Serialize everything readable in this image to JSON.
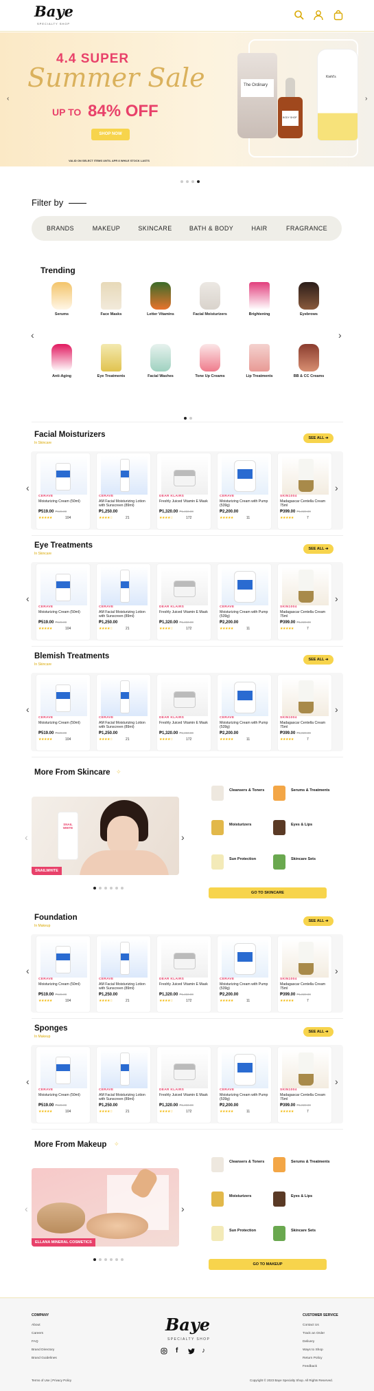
{
  "header": {
    "logo": "Baye",
    "logo_sub": "SPECIALTY SHOP",
    "icons": [
      "search-icon",
      "user-icon",
      "bag-icon"
    ]
  },
  "hero": {
    "line1": "4.4 SUPER",
    "line2": "Summer Sale",
    "upto": "UP TO",
    "percent": "84% OFF",
    "button": "SHOP NOW",
    "note": "VALID ON SELECT ITEMS UNTIL APR 8 WHILE STOCK LASTS",
    "slides": 4,
    "active_slide": 4,
    "product_texts": [
      "The Ordinary",
      "BODY SHOP",
      "Kiehl's"
    ]
  },
  "filter": {
    "title": "Filter by",
    "items": [
      "BRANDS",
      "MAKEUP",
      "SKINCARE",
      "BATH & BODY",
      "HAIR",
      "FRAGRANCE"
    ]
  },
  "trending": {
    "title": "Trending",
    "row1": [
      "Serums",
      "Face Masks",
      "Letter Vitamins",
      "Facial Moisturizers",
      "Brightening",
      "Eyebrows"
    ],
    "row2": [
      "Anti-Aging",
      "Eye Treatments",
      "Facial Washes",
      "Tone Up Creams",
      "Lip Treatments",
      "BB & CC Creams"
    ]
  },
  "product_sections": [
    {
      "title": "Facial Moisturizers",
      "sub": "In Skincare",
      "see_all": "SEE ALL ➔"
    },
    {
      "title": "Eye Treatments",
      "sub": "In Skincare",
      "see_all": "SEE ALL ➔"
    },
    {
      "title": "Blemish Treatments",
      "sub": "In Skincare",
      "see_all": "SEE ALL ➔"
    },
    {
      "title": "Foundation",
      "sub": "In Makeup",
      "see_all": "SEE ALL ➔"
    },
    {
      "title": "Sponges",
      "sub": "In Makeup",
      "see_all": "SEE ALL ➔"
    }
  ],
  "products": [
    {
      "brand": "CERAVE",
      "name": "Moisturizing Cream (50ml)",
      "price": "₱519.00",
      "old": "₱649.00",
      "stars": "★★★★★",
      "count": "104"
    },
    {
      "brand": "CERAVE",
      "name": "AM Facial Moisturizing Lotion with Sunscreen (89ml)",
      "price": "₱1,250.00",
      "old": "",
      "stars": "★★★★☆",
      "count": "21"
    },
    {
      "brand": "DEAR KLAIRS",
      "name": "Freshly Juiced Vitamin E Mask",
      "price": "₱1,320.00",
      "old": "₱1,450.00",
      "stars": "★★★★☆",
      "count": "172"
    },
    {
      "brand": "CERAVE",
      "name": "Moisturizing Cream with Pump (539g)",
      "price": "₱2,200.00",
      "old": "",
      "stars": "★★★★★",
      "count": "11"
    },
    {
      "brand": "SKIN1004",
      "name": "Madagascar Centella Cream 75ml",
      "price": "₱399.00",
      "old": "₱1,020.00",
      "stars": "★★★★★",
      "count": "7"
    }
  ],
  "more_skincare": {
    "title": "More From Skincare",
    "tag": "SNAILWHITE",
    "img_text": "SNAIL WHITE",
    "cats": [
      "Cleansers & Toners",
      "Serums & Treatments",
      "Moisturizers",
      "Eyes & Lips",
      "Sun Protection",
      "Skincare Sets"
    ],
    "button": "GO TO SKINCARE"
  },
  "more_makeup": {
    "title": "More From Makeup",
    "tag": "ELLANA MINERAL COSMETICS",
    "cats": [
      "Cleansers & Toners",
      "Serums & Treatments",
      "Moisturizers",
      "Eyes & Lips",
      "Sun Protection",
      "Skincare Sets"
    ],
    "button": "GO TO MAKEUP"
  },
  "footer": {
    "company_title": "COMPANY",
    "company_links": [
      "About",
      "Careers",
      "FAQ",
      "Brand Directory",
      "Brand Guidelines"
    ],
    "service_title": "CUSTOMER SERVICE",
    "service_links": [
      "Contact Us",
      "Track an Order",
      "Delivery",
      "Ways to Shop",
      "Return Policy",
      "Feedback"
    ],
    "logo": "Baye",
    "logo_sub": "SPECIALTY SHOP",
    "social": [
      "instagram-icon",
      "facebook-icon",
      "twitter-icon",
      "tiktok-icon"
    ],
    "legal": "Terms of Use | Privacy Policy",
    "copyright": "Copyright © 2023 Baye Specialty Shop. All Rights Reserved."
  },
  "colors": {
    "accent": "#f7d44c",
    "sale_red": "#e8416a",
    "brand_gold": "#d9a800"
  }
}
